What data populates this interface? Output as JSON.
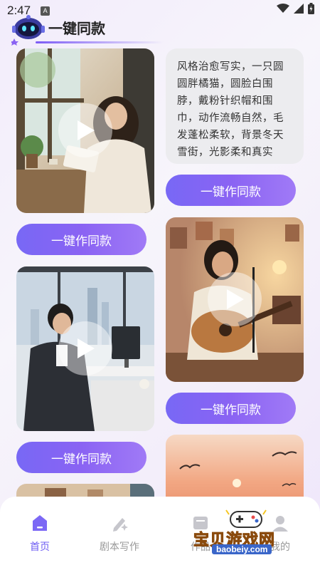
{
  "status_bar": {
    "time": "2:47",
    "notification_badge": "A"
  },
  "header": {
    "title": "一键同款"
  },
  "feed": {
    "left": [
      {
        "type": "video",
        "scene": "woman-reading-by-window",
        "action_label": "一键作同款"
      },
      {
        "type": "video",
        "scene": "man-working-at-desk",
        "action_label": "一键作同款"
      },
      {
        "type": "video",
        "scene": "room-partial"
      }
    ],
    "right": [
      {
        "type": "prompt",
        "text": "风格治愈写实，一只圆圆胖橘猫，圆脸白围脖，戴粉针织帽和围巾，动作流畅自然，毛发蓬松柔软，背景冬天雪街，光影柔和真实",
        "action_label": "一键作同款"
      },
      {
        "type": "video",
        "scene": "woman-singing-with-guitar",
        "action_label": "一键作同款"
      },
      {
        "type": "video",
        "scene": "sunset-with-seagulls"
      }
    ]
  },
  "bottom_nav": {
    "items": [
      {
        "label": "首页",
        "icon": "home-icon",
        "active": true
      },
      {
        "label": "剧本写作",
        "icon": "pen-sparkle-icon",
        "active": false
      },
      {
        "label": "作品",
        "icon": "works-icon",
        "active": false
      },
      {
        "label": "我的",
        "icon": "profile-icon",
        "active": false
      }
    ]
  },
  "watermark": {
    "text": "宝贝游戏网",
    "url": "baobeiy.com"
  },
  "colors": {
    "accent": "#6e5cf3",
    "button_gradient_start": "#7868f5",
    "button_gradient_end": "#a07af6"
  }
}
